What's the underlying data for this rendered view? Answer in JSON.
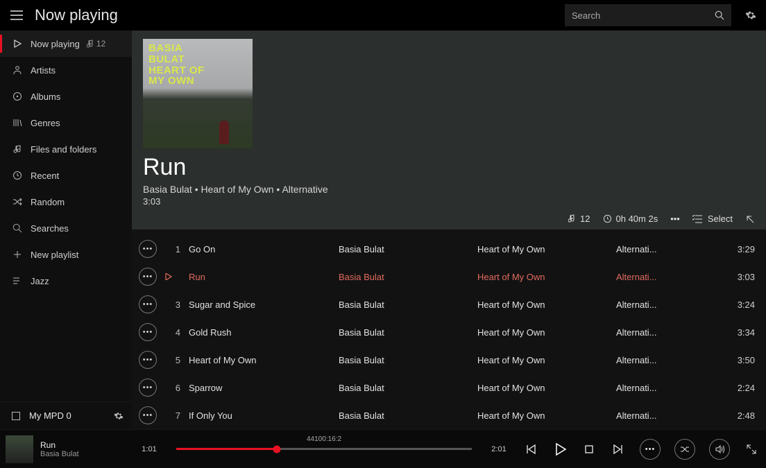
{
  "header": {
    "title": "Now playing",
    "search_placeholder": "Search"
  },
  "sidebar": {
    "items": [
      {
        "label": "Now playing",
        "count": "12"
      },
      {
        "label": "Artists"
      },
      {
        "label": "Albums"
      },
      {
        "label": "Genres"
      },
      {
        "label": "Files and folders"
      },
      {
        "label": "Recent"
      },
      {
        "label": "Random"
      },
      {
        "label": "Searches"
      },
      {
        "label": "New playlist"
      },
      {
        "label": "Jazz"
      }
    ],
    "server": "My MPD 0"
  },
  "hero": {
    "album_art_lines": [
      "BASIA",
      "BULAT",
      "HEART OF",
      "MY OWN"
    ],
    "title": "Run",
    "artist": "Basia Bulat",
    "album": "Heart of My Own",
    "genre": "Alternative",
    "duration": "3:03",
    "queue_count": "12",
    "queue_duration": "0h 40m 2s",
    "select_label": "Select"
  },
  "tracks": [
    {
      "num": "1",
      "title": "Go On",
      "artist": "Basia Bulat",
      "album": "Heart of My Own",
      "genre": "Alternati...",
      "duration": "3:29",
      "playing": false
    },
    {
      "num": "",
      "title": "Run",
      "artist": "Basia Bulat",
      "album": "Heart of My Own",
      "genre": "Alternati...",
      "duration": "3:03",
      "playing": true
    },
    {
      "num": "3",
      "title": "Sugar and Spice",
      "artist": "Basia Bulat",
      "album": "Heart of My Own",
      "genre": "Alternati...",
      "duration": "3:24",
      "playing": false
    },
    {
      "num": "4",
      "title": "Gold Rush",
      "artist": "Basia Bulat",
      "album": "Heart of My Own",
      "genre": "Alternati...",
      "duration": "3:34",
      "playing": false
    },
    {
      "num": "5",
      "title": "Heart of My Own",
      "artist": "Basia Bulat",
      "album": "Heart of My Own",
      "genre": "Alternati...",
      "duration": "3:50",
      "playing": false
    },
    {
      "num": "6",
      "title": "Sparrow",
      "artist": "Basia Bulat",
      "album": "Heart of My Own",
      "genre": "Alternati...",
      "duration": "2:24",
      "playing": false
    },
    {
      "num": "7",
      "title": "If Only You",
      "artist": "Basia Bulat",
      "album": "Heart of My Own",
      "genre": "Alternati...",
      "duration": "2:48",
      "playing": false
    }
  ],
  "player": {
    "title": "Run",
    "artist": "Basia Bulat",
    "elapsed": "1:01",
    "total": "2:01",
    "format": "44100:16:2"
  }
}
